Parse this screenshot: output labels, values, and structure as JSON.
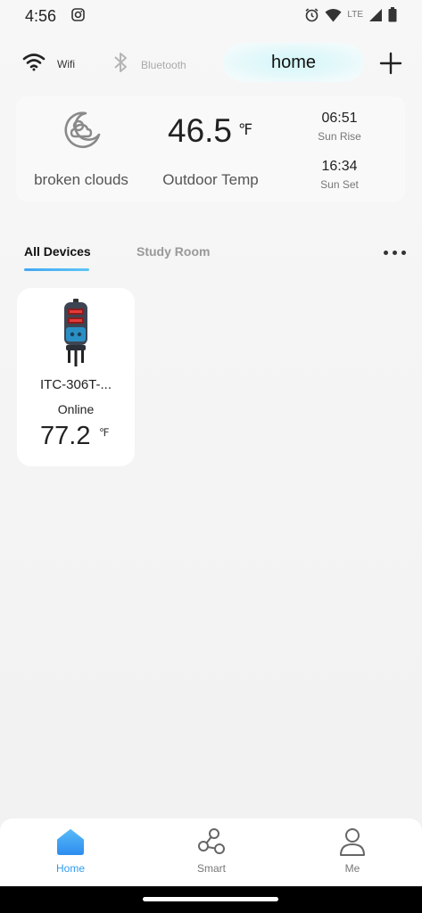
{
  "status_bar": {
    "time": "4:56",
    "network": "LTE",
    "icons": [
      "instagram-icon",
      "alarm-icon",
      "wifi-signal-icon",
      "cell-signal-icon",
      "battery-icon"
    ]
  },
  "connection": {
    "wifi_label": "Wifi",
    "bluetooth_label": "Bluetooth",
    "home_name": "home"
  },
  "weather": {
    "description": "broken clouds",
    "temperature": "46.5",
    "unit": "℉",
    "temp_label": "Outdoor Temp",
    "sunrise_time": "06:51",
    "sunrise_label": "Sun Rise",
    "sunset_time": "16:34",
    "sunset_label": "Sun Set"
  },
  "tabs": [
    {
      "label": "All Devices",
      "active": true
    },
    {
      "label": "Study Room",
      "active": false
    }
  ],
  "devices": [
    {
      "name": "ITC-306T-...",
      "status": "Online",
      "temperature": "77.2",
      "unit": "℉"
    }
  ],
  "bottom_nav": [
    {
      "label": "Home",
      "icon": "home-icon",
      "active": true
    },
    {
      "label": "Smart",
      "icon": "share-nodes-icon",
      "active": false
    },
    {
      "label": "Me",
      "icon": "person-icon",
      "active": false
    }
  ],
  "colors": {
    "accent": "#2f9cf0",
    "home_pill": "#d4f6f9"
  }
}
